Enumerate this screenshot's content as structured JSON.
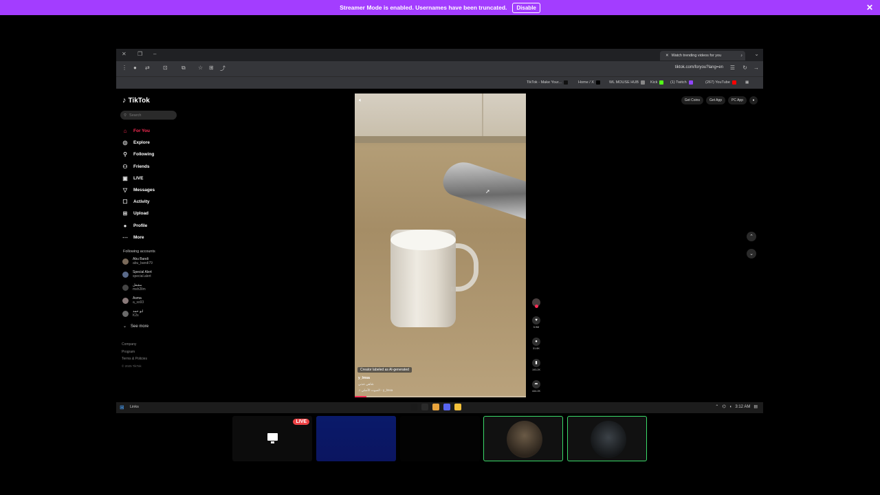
{
  "banner": {
    "message": "Streamer Mode is enabled. Usernames have been truncated.",
    "disable_label": "Disable",
    "close_glyph": "✕"
  },
  "browser": {
    "tab_title": "Watch trending videos for you",
    "url": "tiktok.com/foryou?lang=en",
    "bookmarks": [
      {
        "label": "TikTok - Make Your...",
        "color": "#111111"
      },
      {
        "label": "Home / X",
        "color": "#000000"
      },
      {
        "label": "WL MOUSE HUB",
        "color": "#888888"
      },
      {
        "label": "Kick",
        "color": "#53fc18"
      },
      {
        "label": "(1) Twitch",
        "color": "#9146ff"
      },
      {
        "label": "(267) YouTube",
        "color": "#ff0000"
      }
    ]
  },
  "tiktok": {
    "logo": "TikTok",
    "search_placeholder": "Search",
    "nav": [
      {
        "label": "For You",
        "icon": "home-icon",
        "glyph": "⌂",
        "active": true
      },
      {
        "label": "Explore",
        "icon": "compass-icon",
        "glyph": "◎"
      },
      {
        "label": "Following",
        "icon": "user-plus-icon",
        "glyph": "⚲"
      },
      {
        "label": "Friends",
        "icon": "users-icon",
        "glyph": "⚇"
      },
      {
        "label": "LIVE",
        "icon": "live-icon",
        "glyph": "▣"
      },
      {
        "label": "Messages",
        "icon": "send-icon",
        "glyph": "▽"
      },
      {
        "label": "Activity",
        "icon": "bell-icon",
        "glyph": "☐"
      },
      {
        "label": "Upload",
        "icon": "upload-icon",
        "glyph": "⊞"
      },
      {
        "label": "Profile",
        "icon": "profile-icon",
        "glyph": "●"
      },
      {
        "label": "More",
        "icon": "more-icon",
        "glyph": "⋯"
      }
    ],
    "following_heading": "Following accounts",
    "accounts": [
      {
        "name": "Abu Bandi",
        "handle": "abu_bandi79"
      },
      {
        "name": "Special Alert",
        "handle": "special.alert"
      },
      {
        "name": "مشعل",
        "handle": "msh2llm"
      },
      {
        "name": "Asma",
        "handle": "a_ss93"
      },
      {
        "name": "ابو حمد",
        "handle": "K2s"
      }
    ],
    "see_more": "See more",
    "footer": [
      "Company",
      "Program",
      "Terms & Policies"
    ],
    "copyright": "© 2025 TikTok",
    "top_buttons": [
      "Get Coins",
      "Get App",
      "PC App"
    ],
    "video": {
      "ai_label": "Creator labeled as AI-generated",
      "author": "y_lmsa",
      "description": "شاهي عدني",
      "music": "♫ الصوت الأصلي - y_lmsa",
      "progress_fraction": 0.07
    },
    "actions": [
      {
        "name": "like",
        "glyph": "♥",
        "count": "5.9M"
      },
      {
        "name": "comment",
        "glyph": "●",
        "count": "31.6K"
      },
      {
        "name": "bookmark",
        "glyph": "▮",
        "count": "193.2K"
      },
      {
        "name": "share",
        "glyph": "➦",
        "count": "444.2K"
      }
    ]
  },
  "taskbar": {
    "links_label": "Links",
    "time": "3:12 AM"
  },
  "tiles": {
    "live_badge": "LIVE"
  }
}
